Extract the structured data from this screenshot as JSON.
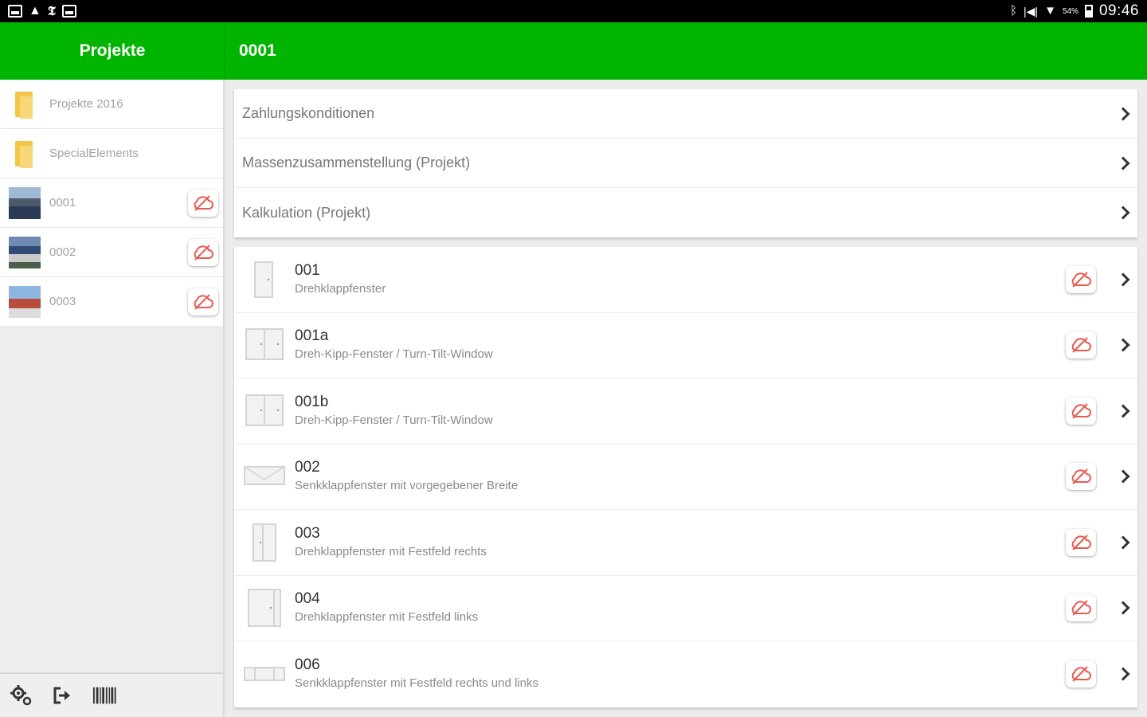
{
  "status_bar": {
    "time": "09:46",
    "battery": "54%",
    "left_icons": [
      "gallery-icon",
      "warning-icon",
      "news-icon",
      "photo-icon"
    ],
    "right_icons": [
      "bluetooth-icon",
      "mute-icon",
      "wifi-icon",
      "battery-icon"
    ]
  },
  "sidebar": {
    "title": "Projekte",
    "items": [
      {
        "label": "Projekte 2016",
        "icon": "folder-icon",
        "cloud": false
      },
      {
        "label": "SpecialElements",
        "icon": "folder-icon",
        "cloud": false
      },
      {
        "label": "0001",
        "icon": "project-photo",
        "cloud": true
      },
      {
        "label": "0002",
        "icon": "project-photo",
        "cloud": true
      },
      {
        "label": "0003",
        "icon": "project-photo",
        "cloud": true
      }
    ],
    "tools": [
      "settings-icon",
      "logout-icon",
      "barcode-icon"
    ]
  },
  "main": {
    "title": "0001",
    "menu": [
      {
        "label": "Zahlungskonditionen"
      },
      {
        "label": "Massenzusammenstellung (Projekt)"
      },
      {
        "label": "Kalkulation (Projekt)"
      }
    ],
    "items": [
      {
        "title": "001",
        "subtitle": "Drehklappfenster"
      },
      {
        "title": "001a",
        "subtitle": "Dreh-Kipp-Fenster / Turn-Tilt-Window"
      },
      {
        "title": "001b",
        "subtitle": "Dreh-Kipp-Fenster / Turn-Tilt-Window"
      },
      {
        "title": "002",
        "subtitle": "Senkklappfenster mit vorgegebener Breite"
      },
      {
        "title": "003",
        "subtitle": "Drehklappfenster mit Festfeld rechts"
      },
      {
        "title": "004",
        "subtitle": "Drehklappfenster mit Festfeld links"
      },
      {
        "title": "006",
        "subtitle": "Senkklappfenster mit Festfeld rechts und links"
      }
    ]
  },
  "colors": {
    "accent_green": "#00b400",
    "cloud_red": "#e85a4f"
  }
}
